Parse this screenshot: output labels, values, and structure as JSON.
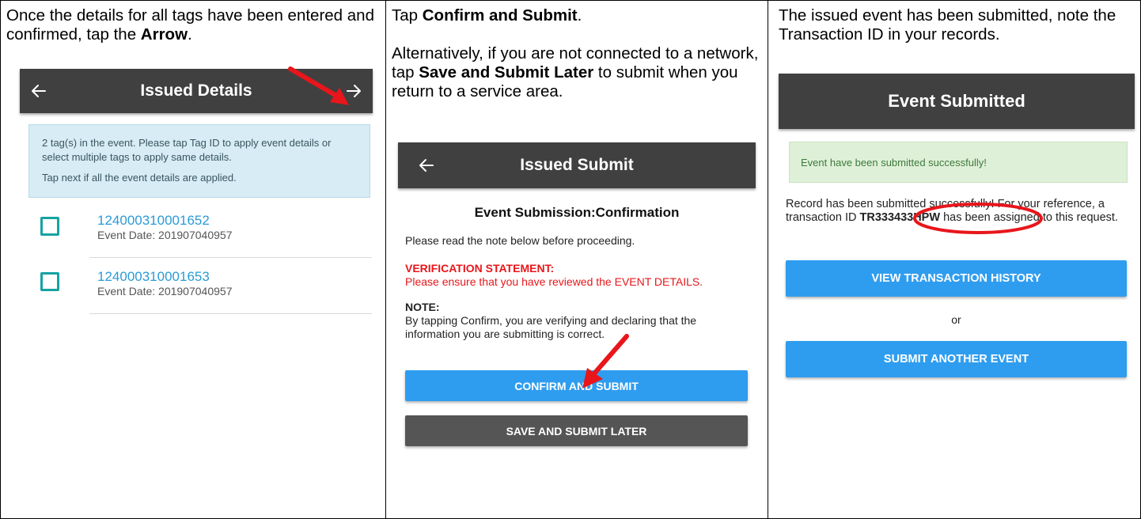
{
  "panel1": {
    "instruction_pre": "Once the details for all tags have been entered and confirmed, tap the ",
    "instruction_bold": "Arrow",
    "instruction_post": ".",
    "appbar_title": "Issued Details",
    "info_line1": "2 tag(s) in the event. Please tap Tag ID to apply event details or select multiple tags to apply same details.",
    "info_line2": "Tap next if all the event details are applied.",
    "tags": [
      {
        "id": "124000310001652",
        "date": "Event Date: 201907040957"
      },
      {
        "id": "124000310001653",
        "date": "Event Date: 201907040957"
      }
    ],
    "icons": {
      "back": "arrow-left-icon",
      "next": "arrow-right-icon"
    }
  },
  "panel2": {
    "instruction_pre": "Tap ",
    "instruction_bold": "Confirm and Submit",
    "instruction_post": ".",
    "alt_pre": "Alternatively, if you are not connected to a network, tap ",
    "alt_bold": "Save and Submit Later",
    "alt_post": " to submit when you return to a service area.",
    "appbar_title": "Issued Submit",
    "heading": "Event Submission:Confirmation",
    "note_intro": "Please read the note below before proceeding.",
    "verification_title": "VERIFICATION STATEMENT:",
    "verification_text": "Please ensure that you have reviewed the EVENT DETAILS.",
    "note_title": "NOTE:",
    "note_text": "By tapping Confirm, you are verifying and declaring that the information you are submitting is correct.",
    "confirm_label": "CONFIRM AND SUBMIT",
    "save_label": "SAVE AND SUBMIT LATER"
  },
  "panel3": {
    "instruction": "The issued event has been submitted, note the Transaction ID in your records.",
    "appbar_title": "Event Submitted",
    "success_text": "Event have been submitted successfully!",
    "record_pre": "Record has been submitted successfully! For your reference, a transaction ID ",
    "transaction_id": "TR333433HPW",
    "record_post": " has been assigned to this request.",
    "view_history_label": "VIEW TRANSACTION HISTORY",
    "or_text": "or",
    "submit_another_label": "SUBMIT ANOTHER EVENT"
  },
  "colors": {
    "appbar": "#404040",
    "primary_button": "#2f9def",
    "secondary_button": "#555555",
    "link": "#2a9bd6",
    "checkbox": "#17a2a2",
    "annotation": "#e8161b",
    "info_bg": "#d7ecf4",
    "success_bg": "#dff0d8"
  }
}
